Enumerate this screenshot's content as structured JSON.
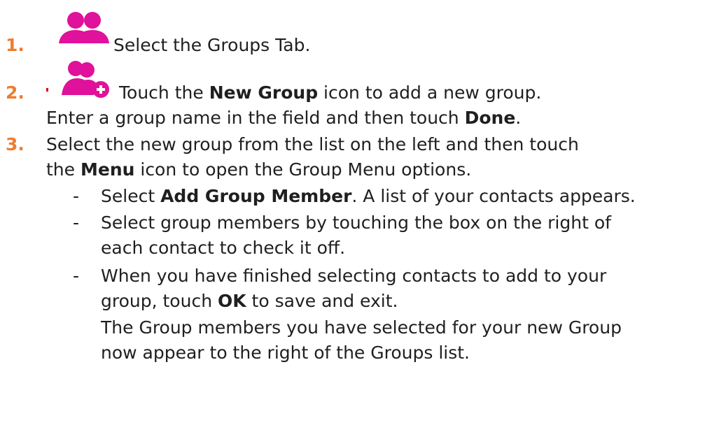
{
  "accent_color": "#e0119a",
  "number_color": "#ed7d31",
  "steps": [
    {
      "number": "1.",
      "icon": "groups-icon",
      "line1": "Select the Groups Tab."
    },
    {
      "number": "2.",
      "icon": "new-group-icon",
      "line1_pre": "Touch the ",
      "line1_bold": "New Group",
      "line1_post": " icon to add a new group.",
      "line2_pre": "Enter a group name in the field and then touch ",
      "line2_bold": "Done",
      "line2_post": "."
    },
    {
      "number": "3.",
      "line1": "Select the new group from the list on the left and then touch",
      "line2_pre": "the ",
      "line2_bold": "Menu",
      "line2_post": " icon to open the Group Menu options.",
      "bullets": [
        {
          "dash": "-",
          "l1_pre": "Select ",
          "l1_bold": "Add Group Member",
          "l1_post": ".  A list of your contacts appears."
        },
        {
          "dash": "-",
          "l1": "Select group members by touching the box on the right of",
          "l2": "each contact to check it off."
        },
        {
          "dash": "-",
          "l1": "When you have finished selecting contacts to add to your",
          "l2_pre": "group, touch ",
          "l2_bold": "OK",
          "l2_post": " to save and exit.",
          "l3": "The Group members you have selected for your new Group",
          "l4": "now appear to the right of the Groups list."
        }
      ]
    }
  ]
}
